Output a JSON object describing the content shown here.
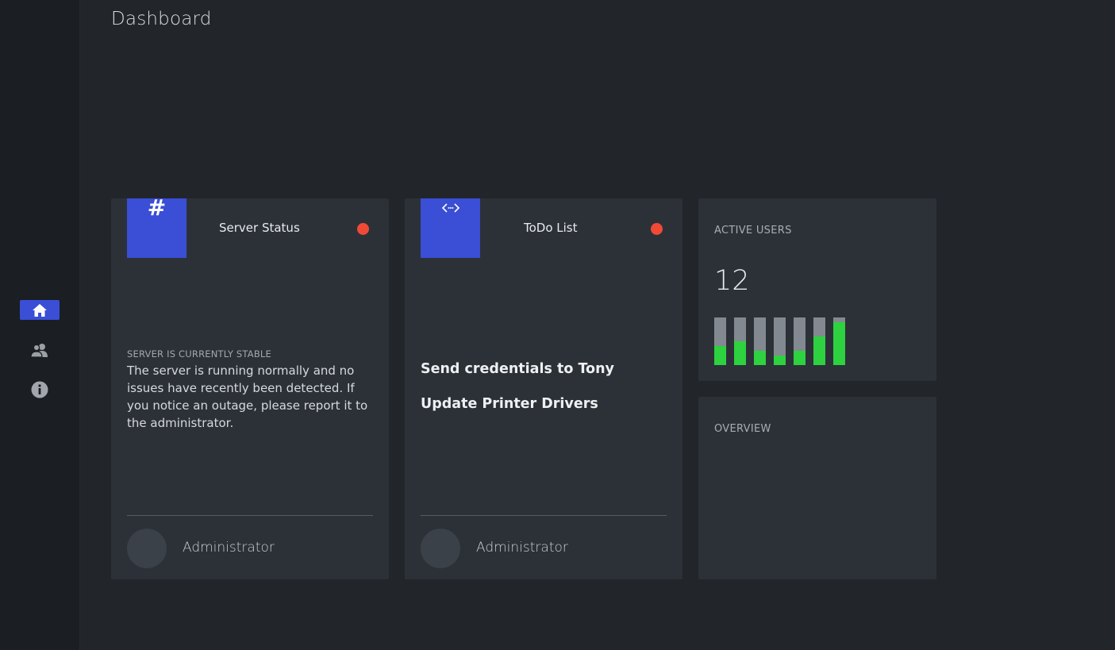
{
  "nav": {
    "items": [
      {
        "icon": "home-icon",
        "active": true
      },
      {
        "icon": "users-icon",
        "active": false
      },
      {
        "icon": "info-icon",
        "active": false
      }
    ]
  },
  "page": {
    "title": "Dashboard"
  },
  "server_card": {
    "tile_icon": "hash-icon",
    "tile_glyph": "#",
    "title": "Server Status",
    "status_color": "#f04a36",
    "status_heading": "Server is currently stable",
    "status_text": "The server is running normally and no issues have recently been detected. If you notice an outage, please report it to the administrator.",
    "author": "Administrator"
  },
  "todo_card": {
    "tile_icon": "code-icon",
    "title": "ToDo List",
    "status_color": "#f04a36",
    "items": [
      "Send credentials to Tony",
      "Update Printer Drivers"
    ],
    "author": "Administrator"
  },
  "active_users": {
    "label": "Active Users",
    "count": "12",
    "bar_levels": [
      0.4,
      0.5,
      0.3,
      0.2,
      0.3,
      0.6,
      0.9
    ],
    "colors": {
      "fill": "#2ed13f",
      "track": "#828991"
    }
  },
  "overview": {
    "label": "Overview"
  },
  "colors": {
    "accent": "#3a4ed6",
    "background": "#22262b",
    "card": "#2c3138",
    "alert": "#f04a36"
  }
}
